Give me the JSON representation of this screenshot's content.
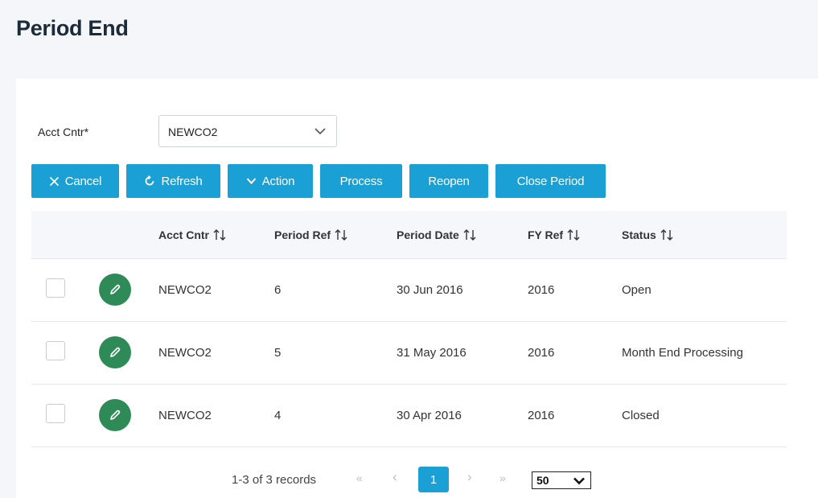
{
  "page": {
    "title": "Period End"
  },
  "filter": {
    "label": "Acct Cntr*",
    "value": "NEWCO2"
  },
  "toolbar": {
    "cancel": "Cancel",
    "refresh": "Refresh",
    "action": "Action",
    "process": "Process",
    "reopen": "Reopen",
    "close_period": "Close Period"
  },
  "table": {
    "columns": [
      "Acct Cntr",
      "Period Ref",
      "Period Date",
      "FY Ref",
      "Status"
    ],
    "rows": [
      {
        "acct_cntr": "NEWCO2",
        "period_ref": "6",
        "period_date": "30 Jun 2016",
        "fy_ref": "2016",
        "status": "Open"
      },
      {
        "acct_cntr": "NEWCO2",
        "period_ref": "5",
        "period_date": "31 May 2016",
        "fy_ref": "2016",
        "status": "Month End Processing"
      },
      {
        "acct_cntr": "NEWCO2",
        "period_ref": "4",
        "period_date": "30 Apr 2016",
        "fy_ref": "2016",
        "status": "Closed"
      }
    ]
  },
  "pagination": {
    "info": "1-3 of 3 records",
    "first": "«",
    "prev": "‹",
    "current_page": "1",
    "next": "›",
    "last": "»",
    "page_size": "50"
  },
  "colors": {
    "primary": "#1aa0d4",
    "edit": "#2e8b57",
    "header_bg": "#f4f6fa"
  },
  "icons": {
    "cancel": "close-icon",
    "refresh": "refresh-icon",
    "action": "chevron-down-icon",
    "edit": "pencil-icon",
    "sort": "sort-icon"
  }
}
